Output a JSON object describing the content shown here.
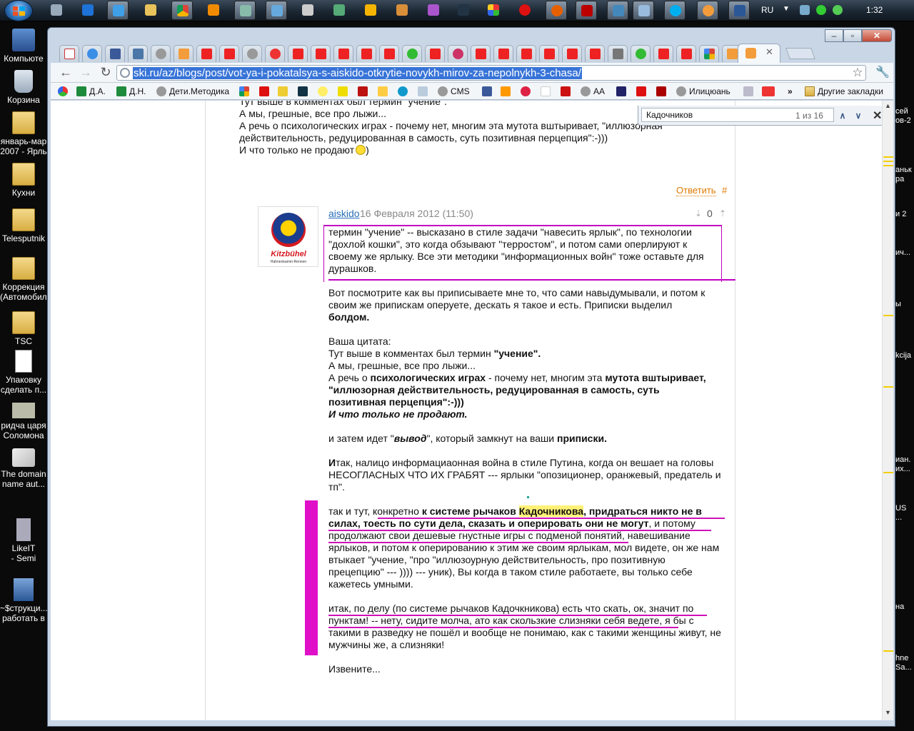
{
  "taskbar": {
    "lang": "RU",
    "time": "1:32"
  },
  "desktop": {
    "icons": [
      "Компьюте",
      "Корзина",
      "январь-мар\n2007 - Ярль",
      "Кухни",
      "Telesputnik",
      "Коррекция\n(Автомобиль",
      "TSC",
      "Упаковку\nсделать п...",
      "ридча царя\nСоломона",
      "The domain\nname aut...",
      "LikeIT\n- Semi",
      "~$струкци...\nработать в"
    ],
    "right_fragments": [
      "сей\nов-2",
      "аньк\nра",
      "и 2",
      "ич...",
      "ы",
      "kcija",
      "иан.\nих...",
      "US\n...",
      "на",
      "hne\nSa..."
    ]
  },
  "browser": {
    "url": "ski.ru/az/blogs/post/vot-ya-i-pokatalsya-s-aiskido-otkrytie-novykh-mirov-za-nepolnykh-3-chasa/",
    "bookmarks": {
      "da": "Д.А.",
      "dn": "Д.Н.",
      "deti": "Дети.Методика",
      "cms": "CMS",
      "aa": "AA",
      "ilitsyun": "Илицюань",
      "other": "Другие закладки",
      "more": "»"
    },
    "find": {
      "query": "Кадочников",
      "count": "1 из 16"
    }
  },
  "post": {
    "prev_lines": [
      "Тут выше в комментах был термин \"учение\".",
      "А мы, грешные, все про лыжи...",
      "А речь о психологических играх - почему нет, многим эта мутота вштыривает, \"иллюзорная",
      "действительность, редуцированная в самость, суть позитивная перцепция\":-)))",
      "И что только не продают"
    ],
    "reply": "Ответить",
    "hash": "#"
  },
  "comment": {
    "avatar_brand": "Kitzbühel",
    "avatar_sub": "Hahnenkamm-Rennen",
    "author": "aiskido",
    "date": "16 Февраля 2012 (11:50)",
    "votes": "0",
    "quote": [
      "термин \"учение\" -- высказано в стиле задачи \"навесить ярлык\", по технологии",
      "\"дохлой кошки\", это когда обзывают \"терростом\", и потом сами оперлируют к",
      "своему же ярлыку. Все эти методики \"информационных войн\" тоже оставьте для",
      "дурашков."
    ],
    "p1": [
      "Вот посмотрите как вы приписываете мне то, что сами навыдумывали, и потом к",
      "своим же припискам оперуете, дескать я такое и есть. Приписки выделил"
    ],
    "p1_bold": "болдом.",
    "cite_label": "Ваша цитата:",
    "cite1_a": "Тут выше в комментах был термин ",
    "cite1_b": "\"учение\".",
    "cite2": "А мы, грешные, все про лыжи...",
    "cite3_a": "А речь о ",
    "cite3_b": "психологических играх",
    "cite3_c": " - почему нет, многим эта ",
    "cite3_d": "мутота вштыривает,",
    "cite4": "\"иллюзорная действительность, редуцированная в самость, суть",
    "cite5": "позитивная перцепция\":-)))",
    "cite6": "И что только не продают.",
    "p2_a": "и затем идет \"",
    "p2_b": "вывод",
    "p2_c": "\", который замкнут на ваши ",
    "p2_d": "приписки.",
    "p3_first": "И",
    "p3": [
      "так, налицо информациаонная война в стиле Путина, когда он вешает на головы",
      "НЕСОГЛАСНЫХ ЧТО ИХ ГРАБЯТ --- ярлыки \"опозиционер, оранжевый, предатель и",
      "тп\"."
    ],
    "p4_a": "так и тут, конкретно ",
    "p4_b": "к системе рычаков ",
    "p4_hl": "Кадочникова",
    "p4_c": ", придраться никто не в",
    "p4_l2": "силах, тоесть по сути дела, сказать и оперировать они не могут",
    "p4_l2_rest": ", и потому",
    "p4_rest": [
      "продолжают свои дешевые гнустные игры с подменой понятий, навешивание",
      "ярлыков, и потом к оперированию к этим же своим ярлыкам, мол видете, он же нам",
      "втыкает \"учение, \"про \"иллюзоурную действительность, про позитивную",
      "прецепцию\" --- )))) --- уник), Вы когда в таком стиле работаете, вы только себе",
      "кажетесь умными."
    ],
    "p5": [
      "итак, по делу (по системе рычаков Кадочкникова) есть что скать, ок, значит по",
      "пунктам! -- нету, сидите молча, ато как скользкие слизняки себя ведете, я  бы с",
      "такими в разведку не пошёл и вообще не понимаю, как с такими женщины живут, не",
      "мужчины же, а слизняки!"
    ],
    "closing": "Извените..."
  }
}
